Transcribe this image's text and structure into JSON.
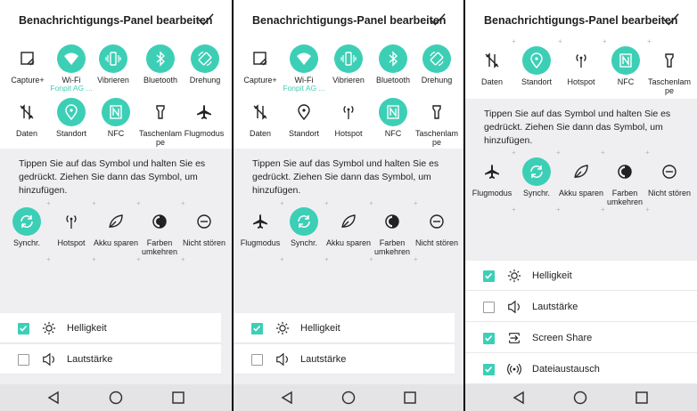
{
  "header": {
    "title": "Benachrichtigungs-Panel bearbeiten"
  },
  "hint": {
    "line1": "Tippen Sie auf das Symbol und halten Sie es",
    "line2": "gedrückt. Ziehen Sie dann das Symbol, um",
    "line3": "hinzufügen."
  },
  "tiles": {
    "capture": "Capture+",
    "wifi": "Wi-Fi",
    "wifi_sub": "Fonpit AG ...",
    "vibrate": "Vibrieren",
    "bluetooth": "Bluetooth",
    "rotation": "Drehung",
    "data": "Daten",
    "location": "Standort",
    "nfc": "NFC",
    "flashlight_1": "Taschenlam",
    "flashlight_2": "pe",
    "flight": "Flugmodus",
    "sync": "Synchr.",
    "hotspot": "Hotspot",
    "battery": "Akku sparen",
    "invert_1": "Farben",
    "invert_2": "umkehren",
    "dnd": "Nicht stören"
  },
  "rows": {
    "brightness": "Helligkeit",
    "volume": "Lautstärke",
    "screenshare": "Screen Share",
    "fileshare": "Dateiaustausch"
  },
  "colors": {
    "accent": "#3dcfb6",
    "grey_bg": "#efeff2"
  }
}
